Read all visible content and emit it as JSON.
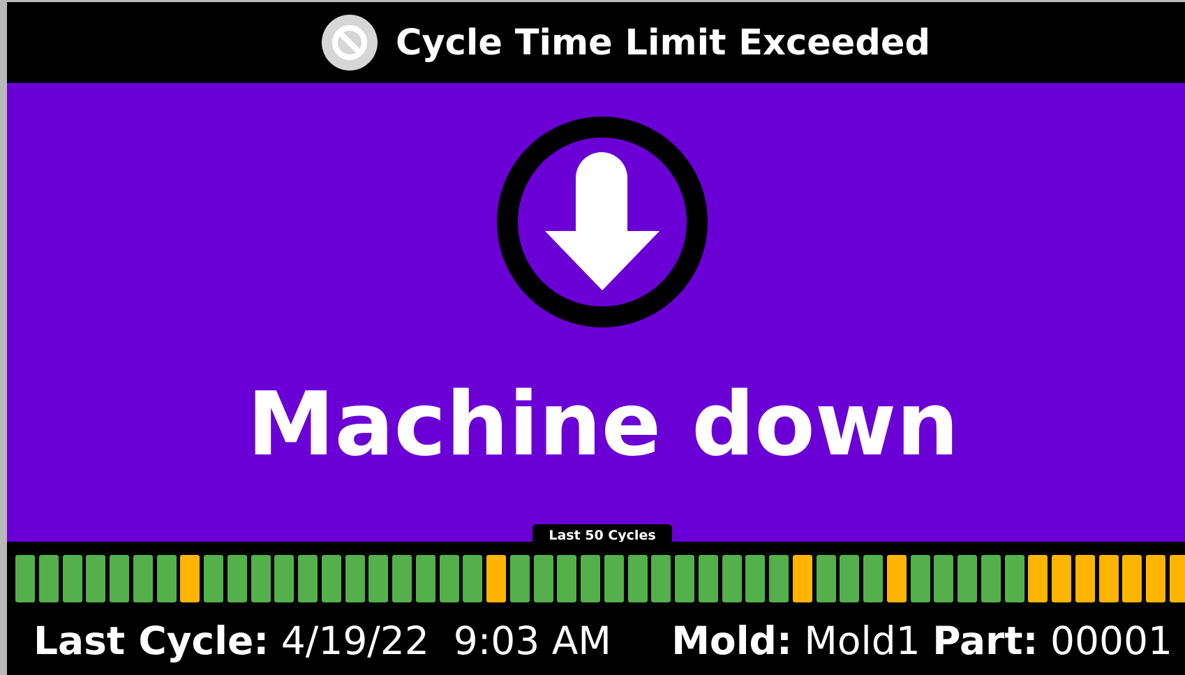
{
  "header": {
    "title": "Cycle Time Limit Exceeded",
    "icon": "no-entry-icon"
  },
  "status": {
    "text": "Machine down",
    "icon": "arrow-down-circle-icon",
    "background_color": "#6b00d6"
  },
  "cycles": {
    "title": "Last 50 Cycles",
    "colors": {
      "ok": "#53b04b",
      "warning": "#ffb400"
    },
    "states": [
      "ok",
      "ok",
      "ok",
      "ok",
      "ok",
      "ok",
      "ok",
      "warning",
      "ok",
      "ok",
      "ok",
      "ok",
      "ok",
      "ok",
      "ok",
      "ok",
      "ok",
      "ok",
      "ok",
      "ok",
      "warning",
      "ok",
      "ok",
      "ok",
      "ok",
      "ok",
      "ok",
      "ok",
      "ok",
      "ok",
      "ok",
      "ok",
      "ok",
      "warning",
      "ok",
      "ok",
      "ok",
      "warning",
      "ok",
      "ok",
      "ok",
      "ok",
      "ok",
      "warning",
      "warning",
      "warning",
      "warning",
      "warning",
      "warning",
      "warning"
    ]
  },
  "footer": {
    "last_cycle_label": "Last Cycle:",
    "last_cycle_value": "4/19/22  9:03 AM",
    "mold_label": "Mold:",
    "mold_value": "Mold1",
    "part_label": "Part:",
    "part_value": "00001"
  }
}
